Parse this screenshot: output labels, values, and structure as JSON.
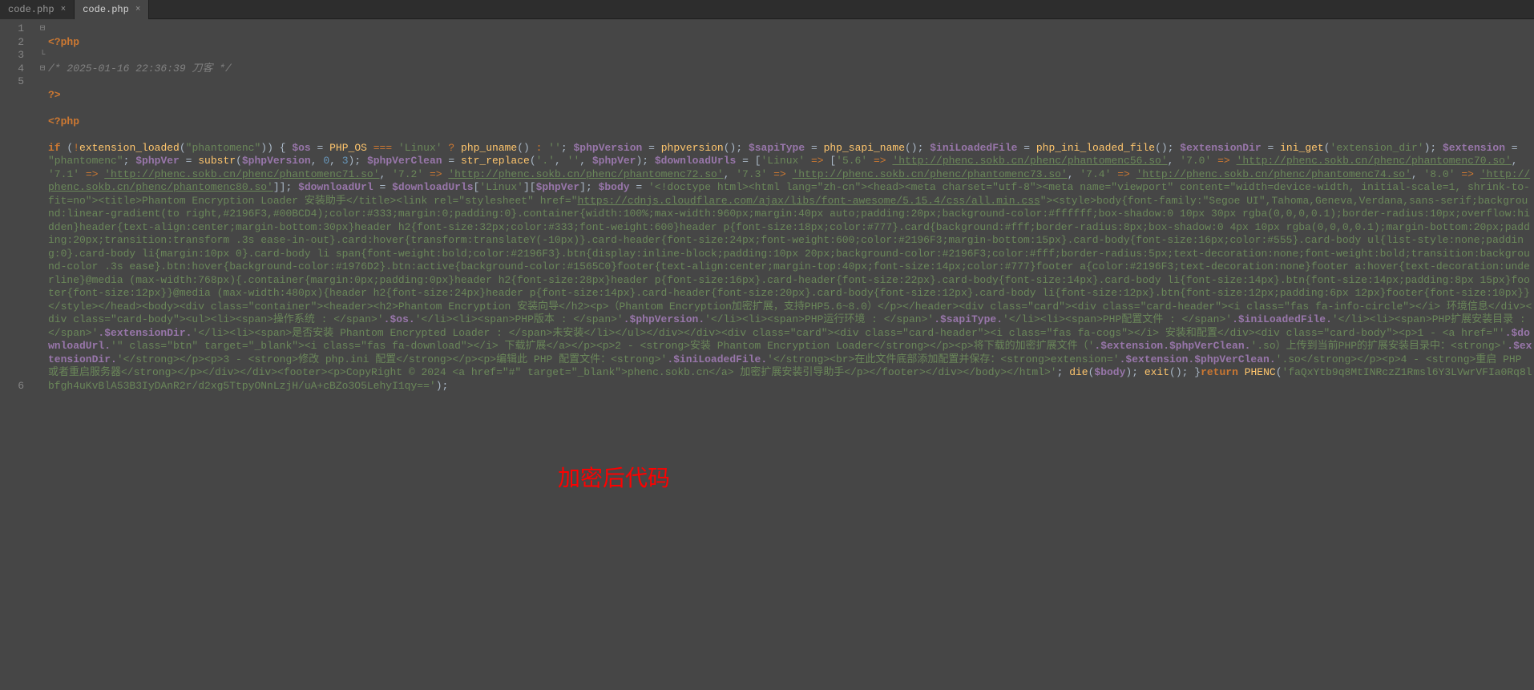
{
  "tabs": [
    {
      "name": "code.php",
      "active": false
    },
    {
      "name": "code.php",
      "active": true
    }
  ],
  "lines": [
    "1",
    "2",
    "3",
    "4",
    "5",
    "6"
  ],
  "caption": "加密后代码",
  "code": {
    "l1_tag": "<?php",
    "l2_comment": "/* 2025-01-16 22:36:39 刀客 */",
    "l3_tag": "?>",
    "l4_tag": "<?php",
    "l5": {
      "if": "if",
      "not": "!",
      "fn1": "extension_loaded",
      "s1": "\"phantomenc\"",
      "var_os": "$os",
      "php_os": "PHP_OS",
      "eqeq": "===",
      "s_linux": "'Linux'",
      "q": "?",
      "fn_uname": "php_uname",
      "colon": ":",
      "s_empty": "''",
      "var_phpver": "$phpVersion",
      "fn_phpver": "phpversion",
      "var_sapi": "$sapiType",
      "fn_sapi": "php_sapi_name",
      "var_ini": "$iniLoadedFile",
      "fn_ini": "php_ini_loaded_file",
      "var_extdir": "$extensionDir",
      "fn_iniget": "ini_get",
      "s_extdir": "'extension_dir'",
      "var_ext": "$extension",
      "s_phantomenc": "\"phantomenc\"",
      "var_phpv": "$phpVer",
      "fn_substr": "substr",
      "n0": "0",
      "n3": "3",
      "var_clean": "$phpVerClean",
      "fn_replace": "str_replace",
      "s_dot": "'.'",
      "s_e2": "''",
      "var_urls": "$downloadUrls",
      "s_linux2": "'Linux'",
      "arrow": "=>",
      "s56": "'5.6'",
      "u56": "'http://phenc.sokb.cn/phenc/phantomenc56.so'",
      "s70": "'7.0'",
      "u70": "'http://phenc.sokb.cn/phenc/phantomenc70.so'",
      "s71": "'7.1'",
      "u71": "'http://phenc.sokb.cn/phenc/phantomenc71.so'",
      "s72": "'7.2'",
      "u72": "'http://phenc.sokb.cn/phenc/phantomenc72.so'",
      "s73": "'7.3'",
      "u73": "'http://phenc.sokb.cn/phenc/phantomenc73.so'",
      "s74": "'7.4'",
      "u74": "'http://phenc.sokb.cn/phenc/phantomenc74.so'",
      "s80": "'8.0'",
      "u80": "'http://phenc.sokb.cn/phenc/phantomenc80.so'",
      "var_durl": "$downloadUrl",
      "var_body": "$body",
      "html1": "'<!doctype html><html lang=\"zh-cn\"><head><meta charset=\"utf-8\"><meta name=\"viewport\" content=\"width=device-width, initial-scale=1, shrink-to-fit=no\"><title>Phantom Encryption Loader 安装助手</title><link rel=\"stylesheet\" href=\"",
      "cdn": "https://cdnjs.cloudflare.com/ajax/libs/font-awesome/5.15.4/css/all.min.css",
      "html2": "\"><style>body{font-family:\"Segoe UI\",Tahoma,Geneva,Verdana,sans-serif;background:linear-gradient(to right,#2196F3,#00BCD4);color:#333;margin:0;padding:0}.container{width:100%;max-width:960px;margin:40px auto;padding:20px;background-color:#ffffff;box-shadow:0 10px 30px rgba(0,0,0,0.1);border-radius:10px;overflow:hidden}header{text-align:center;margin-bottom:30px}header h2{font-size:32px;color:#333;font-weight:600}header p{font-size:18px;color:#777}.card{background:#fff;border-radius:8px;box-shadow:0 4px 10px rgba(0,0,0,0.1);margin-bottom:20px;padding:20px;transition:transform .3s ease-in-out}.card:hover{transform:translateY(-10px)}.card-header{font-size:24px;font-weight:600;color:#2196F3;margin-bottom:15px}.card-body{font-size:16px;color:#555}.card-body ul{list-style:none;padding:0}.card-body li{margin:10px 0}.card-body li span{font-weight:bold;color:#2196F3}.btn{display:inline-block;padding:10px 20px;background-color:#2196F3;color:#fff;border-radius:5px;text-decoration:none;font-weight:bold;transition:background-color .3s ease}.btn:hover{background-color:#1976D2}.btn:active{background-color:#1565C0}footer{text-align:center;margin-top:40px;font-size:14px;color:#777}footer a{color:#2196F3;text-decoration:none}footer a:hover{text-decoration:underline}@media (max-width:768px){.container{margin:0px;padding:0px}header h2{font-size:28px}header p{font-size:16px}.card-header{font-size:22px}.card-body{font-size:14px}.card-body li{font-size:14px}.btn{font-size:14px;padding:8px 15px}footer{font-size:12px}}@media (max-width:480px){header h2{font-size:24px}header p{font-size:14px}.card-header{font-size:20px}.card-body{font-size:12px}.card-body li{font-size:12px}.btn{font-size:12px;padding:6px 12px}footer{font-size:10px}}</style></head><body><div class=\"container\"><header><h2>Phantom Encryption 安装向导</h2><p>（Phantom Encryption加密扩展，支持PHP5.6~8.0）</p></header><div class=\"card\"><div class=\"card-header\"><i class=\"fas fa-info-circle\"></i> 环境信息</div><div class=\"card-body\"><ul><li><span>操作系统 : </span>'",
      "d_os": ".$os.",
      "html3": "'</li><li><span>PHP版本 : </span>'",
      "d_pv": ".$phpVersion.",
      "html4": "'</li><li><span>PHP运行环境 : </span>'",
      "d_sapi": ".$sapiType.",
      "html5": "'</li><li><span>PHP配置文件 : </span>'",
      "d_ini": ".$iniLoadedFile.",
      "html6": "'</li><li><span>PHP扩展安装目录 : </span>'",
      "d_extdir": ".$extensionDir.",
      "html7": "'</li><li><span>是否安装 Phantom Encrypted Loader : </span>未安装</li></ul></div></div><div class=\"card\"><div class=\"card-header\"><i class=\"fas fa-cogs\"></i> 安装和配置</div><div class=\"card-body\"><p>1 - <a href=\"'",
      "d_durl": ".$downloadUrl.",
      "html8": "'\" class=\"btn\" target=\"_blank\"><i class=\"fas fa-download\"></i> 下载扩展</a></p><p>2 - <strong>安装 Phantom Encryption Loader</strong></p><p>将下载的加密扩展文件（'",
      "d_ext": ".$extension.$phpVerClean.",
      "html9": "'.so）上传到当前PHP的扩展安装目录中：<strong>'",
      "d_extdir2": ".$extensionDir.",
      "html10": "'</strong></p><p>3 - <strong>修改 php.ini 配置</strong></p><p>编辑此 PHP 配置文件：<strong>'",
      "d_ini2": ".$iniLoadedFile.",
      "html11": "'</strong><br>在此文件底部添加配置并保存：<strong>extension='",
      "d_ext2": ".$extension.$phpVerClean.",
      "html12": "'.so</strong></p><p>4 - <strong>重启 PHP 或者重启服务器</strong></p></div></div><footer><p>CopyRight © 2024 <a href=\"#\" target=\"_blank\">phenc.sokb.cn</a> 加密扩展安装引导助手</p></footer></div></body></html>'",
      "die": "die",
      "exit": "exit",
      "ret": "return",
      "phenc": "PHENC",
      "encstr": "'faQxYtb9q8MtINRczZ1Rmsl6Y3LVwrVFIa0Rq8lbfgh4uKvBlA53B3IyDAnR2r/d2xg5TtpyONnLzjH/uA+cBZo3O5LehyI1qy=='"
    }
  }
}
